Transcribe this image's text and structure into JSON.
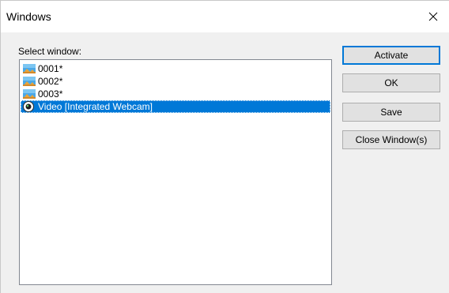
{
  "window": {
    "title": "Windows",
    "close_icon": "close-icon"
  },
  "dialog": {
    "select_label": "Select window:",
    "items": [
      {
        "label": "0001*",
        "icon": "image-icon",
        "selected": false
      },
      {
        "label": "0002*",
        "icon": "image-icon",
        "selected": false
      },
      {
        "label": "0003*",
        "icon": "image-icon",
        "selected": false
      },
      {
        "label": "Video [Integrated Webcam]",
        "icon": "webcam-icon",
        "selected": true
      }
    ]
  },
  "buttons": {
    "activate": "Activate",
    "ok": "OK",
    "save": "Save",
    "close_windows": "Close Window(s)"
  },
  "colors": {
    "selection": "#0078d7",
    "default_button_border": "#0078d7",
    "button_face": "#e1e1e1"
  }
}
